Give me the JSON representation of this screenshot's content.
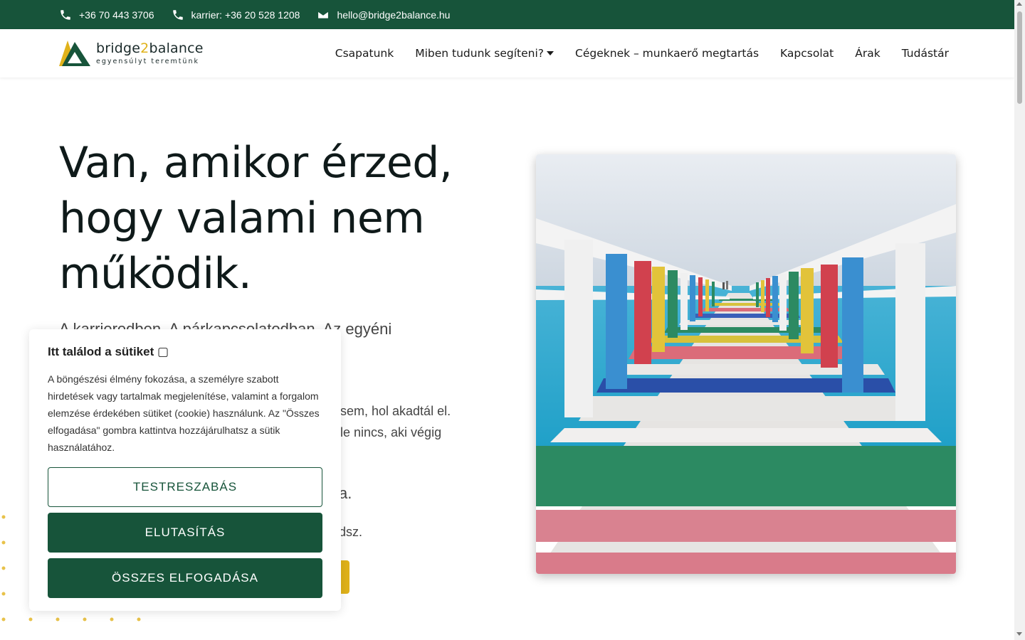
{
  "topbar": {
    "phone": "+36 70 443 3706",
    "career_phone": "karrier: +36 20 528 1208",
    "email": "hello@bridge2balance.hu",
    "bg_color": "#17543a"
  },
  "logo": {
    "name_part1": "bridge",
    "name_part2": "2",
    "name_part3": "balance",
    "tagline": "egyensúlyt teremtünk"
  },
  "nav": {
    "items": [
      {
        "label": "Csapatunk"
      },
      {
        "label": "Miben tudunk segíteni?"
      },
      {
        "label": "Cégeknek – munkaerő megtartás"
      },
      {
        "label": "Kapcsolat"
      },
      {
        "label": "Árak"
      },
      {
        "label": "Tudástár"
      }
    ]
  },
  "hero": {
    "title": "Van, amikor érzed, hogy valami nem működik.",
    "subtitle": "A karrieredben. A párkapcsolatodban. Az egyéni",
    "p1": "sem, hol akadtál el. le nincs, aki végig",
    "p2": "a.",
    "p3": "dsz.",
    "image_icon": "rainbow-pier-photo",
    "cta_color": "#e0b21a"
  },
  "cookie": {
    "title": "Itt találod a sütiket ",
    "text": "A böngészési élmény fokozása, a személyre szabott hirdetések vagy tartalmak megjelenítése, valamint a forgalom elemzése érdekében sütiket (cookie) használunk. Az \"Összes elfogadása\" gombra kattintva hozzájárulhatsz a sütik használatához.",
    "customize_label": "TESTRESZABÁS",
    "reject_label": "ELUTASÍTÁS",
    "accept_label": "ÖSSZES ELFOGADÁSA"
  }
}
